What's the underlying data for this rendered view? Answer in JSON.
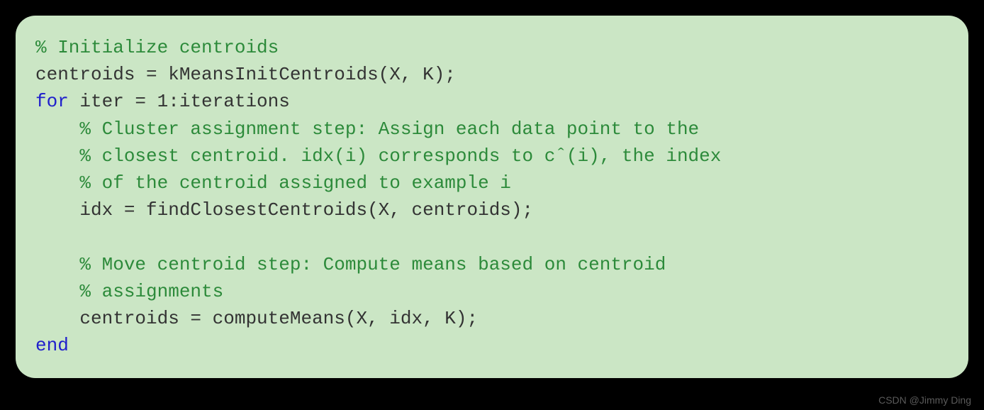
{
  "code": {
    "line1_comment": "% Initialize centroids",
    "line2": "centroids = kMeansInitCentroids(X, K);",
    "line3_keyword": "for",
    "line3_rest": " iter = 1:iterations",
    "line4_comment": "    % Cluster assignment step: Assign each data point to the",
    "line5_comment": "    % closest centroid. idx(i) corresponds to cˆ(i), the index",
    "line6_comment": "    % of the centroid assigned to example i",
    "line7": "    idx = findClosestCentroids(X, centroids);",
    "line8": "",
    "line9_comment": "    % Move centroid step: Compute means based on centroid",
    "line10_comment": "    % assignments",
    "line11": "    centroids = computeMeans(X, idx, K);",
    "line12_keyword": "end"
  },
  "watermark": "CSDN @Jimmy Ding"
}
